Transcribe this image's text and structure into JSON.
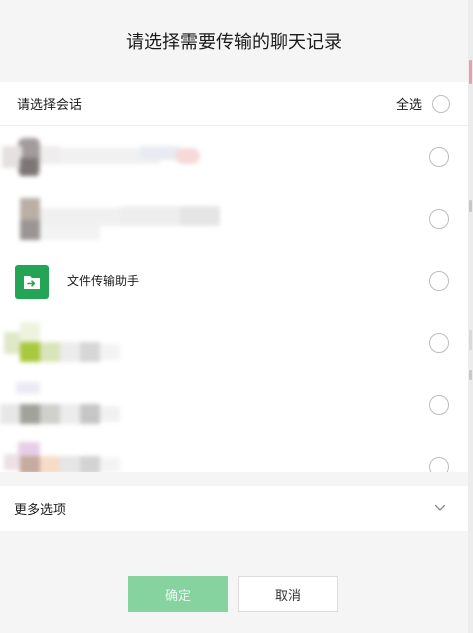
{
  "dialog": {
    "title": "请选择需要传输的聊天记录"
  },
  "selection": {
    "label": "请选择会话",
    "select_all_label": "全选"
  },
  "conversations": [
    {
      "name": "",
      "obscured": true,
      "selected": false
    },
    {
      "name": "",
      "obscured": true,
      "selected": false
    },
    {
      "name": "文件传输助手",
      "icon": "file-transfer-folder-icon",
      "icon_color": "#23a555",
      "obscured": false,
      "selected": false
    },
    {
      "name": "",
      "obscured": true,
      "selected": false
    },
    {
      "name": "",
      "obscured": true,
      "selected": false
    },
    {
      "name": "",
      "obscured": true,
      "selected": false
    }
  ],
  "more_options": {
    "label": "更多选项",
    "icon": "chevron-down-icon"
  },
  "buttons": {
    "confirm_label": "确定",
    "cancel_label": "取消"
  },
  "colors": {
    "accent_green": "#23a555",
    "confirm_disabled_bg": "#87d3a0",
    "page_bg": "#f5f5f5"
  }
}
